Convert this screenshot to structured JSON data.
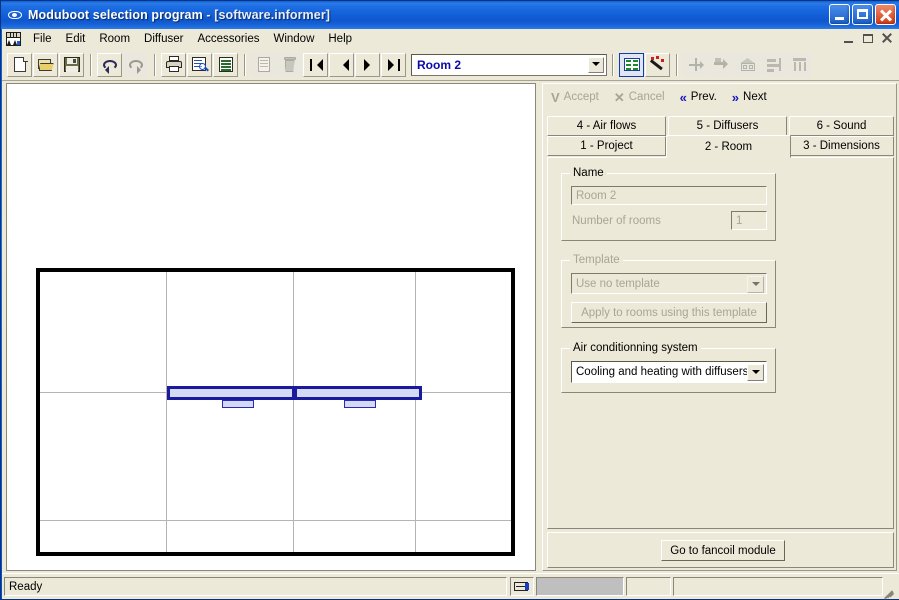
{
  "window": {
    "title_main": "Moduboot selection program",
    "title_doc": " - [software.informer]",
    "icon": "eye-icon",
    "caption_buttons": [
      "minimize",
      "maximize",
      "close"
    ]
  },
  "menu": {
    "doc_icon": "document-properties-icon",
    "items": [
      "File",
      "Edit",
      "Room",
      "Diffuser",
      "Accessories",
      "Window",
      "Help"
    ],
    "mdi_buttons": [
      "minimize",
      "restore",
      "close"
    ]
  },
  "toolbar": {
    "buttons": [
      {
        "name": "new",
        "icon": "new-document-icon",
        "enabled": true
      },
      {
        "name": "open",
        "icon": "open-folder-icon",
        "enabled": true
      },
      {
        "name": "save",
        "icon": "save-diskette-icon",
        "enabled": true
      },
      {
        "name": "undo",
        "icon": "undo-arrow-icon",
        "enabled": true
      },
      {
        "name": "redo",
        "icon": "redo-arrow-icon",
        "enabled": false
      },
      {
        "name": "print",
        "icon": "printer-icon",
        "enabled": true
      },
      {
        "name": "print-preview",
        "icon": "print-preview-icon",
        "enabled": true
      },
      {
        "name": "report",
        "icon": "report-list-icon",
        "enabled": true
      },
      {
        "name": "duplicate",
        "icon": "copy-document-icon",
        "enabled": false
      },
      {
        "name": "delete",
        "icon": "trash-can-icon",
        "enabled": false
      },
      {
        "name": "first-record",
        "icon": "first-record-icon",
        "enabled": true
      },
      {
        "name": "previous-record",
        "icon": "previous-record-icon",
        "enabled": true
      },
      {
        "name": "next-record",
        "icon": "next-record-icon",
        "enabled": true
      },
      {
        "name": "last-record",
        "icon": "last-record-icon",
        "enabled": true
      }
    ],
    "room_selector": {
      "value": "Room 2"
    },
    "right_buttons": [
      {
        "name": "properties-list",
        "icon": "properties-list-icon",
        "enabled": true,
        "pressed": true
      },
      {
        "name": "wizard",
        "icon": "magic-wand-icon",
        "enabled": true,
        "pressed": false
      },
      {
        "name": "duct-tool",
        "icon": "duct-branch-icon",
        "enabled": false
      },
      {
        "name": "flow-tool",
        "icon": "flow-arrow-icon",
        "enabled": false
      },
      {
        "name": "plenum-tool",
        "icon": "plenum-box-icon",
        "enabled": false
      },
      {
        "name": "balance-tool",
        "icon": "balance-sliders-icon",
        "enabled": false
      },
      {
        "name": "diffuser-tool",
        "icon": "diffuser-grid-icon",
        "enabled": false
      }
    ]
  },
  "canvas": {
    "name": "room-drawing-canvas",
    "room_outline": {
      "label": "room-boundary"
    },
    "grid_lines": {
      "vertical": 3,
      "horizontal": 2
    },
    "diffusers": [
      {
        "name": "diffuser-bar-left"
      },
      {
        "name": "diffuser-bar-right"
      },
      {
        "name": "diffuser-tab-left"
      },
      {
        "name": "diffuser-tab-right"
      }
    ]
  },
  "panel": {
    "actions": [
      {
        "label": "Accept",
        "glyph": "V",
        "icon": "check-icon",
        "enabled": false
      },
      {
        "label": "Cancel",
        "glyph": "✕",
        "icon": "cross-icon",
        "enabled": false
      },
      {
        "label": "Prev.",
        "glyph": "«",
        "icon": "prev-chevron-icon",
        "enabled": true
      },
      {
        "label": "Next",
        "glyph": "»",
        "icon": "next-chevron-icon",
        "enabled": true
      }
    ],
    "tabs_row1": [
      {
        "label": "4 - Air flows",
        "selected": false
      },
      {
        "label": "5 - Diffusers",
        "selected": false
      },
      {
        "label": "6 - Sound",
        "selected": false
      }
    ],
    "tabs_row2": [
      {
        "label": "1 - Project",
        "selected": false
      },
      {
        "label": "2 - Room",
        "selected": true
      },
      {
        "label": "3 - Dimensions",
        "selected": false
      }
    ],
    "name_group": {
      "title": "Name",
      "room_name_value": "Room 2",
      "number_of_rooms_label": "Number of rooms",
      "number_of_rooms_value": "1"
    },
    "template_group": {
      "title": "Template",
      "template_value": "Use no template",
      "apply_button": "Apply to rooms using this template"
    },
    "ac_group": {
      "title": "Air conditionning system",
      "value": "Cooling and heating with diffusers"
    },
    "fancoil_button": "Go to fancoil module"
  },
  "status": {
    "ready": "Ready",
    "icon": "measure-icon"
  },
  "colors": {
    "title_blue": "#1460d8",
    "face": "#ece9d8",
    "accent_blue": "#0a0aa8",
    "diffuser_outline": "#1a1a9e",
    "diffuser_fill": "#d4daf4"
  }
}
